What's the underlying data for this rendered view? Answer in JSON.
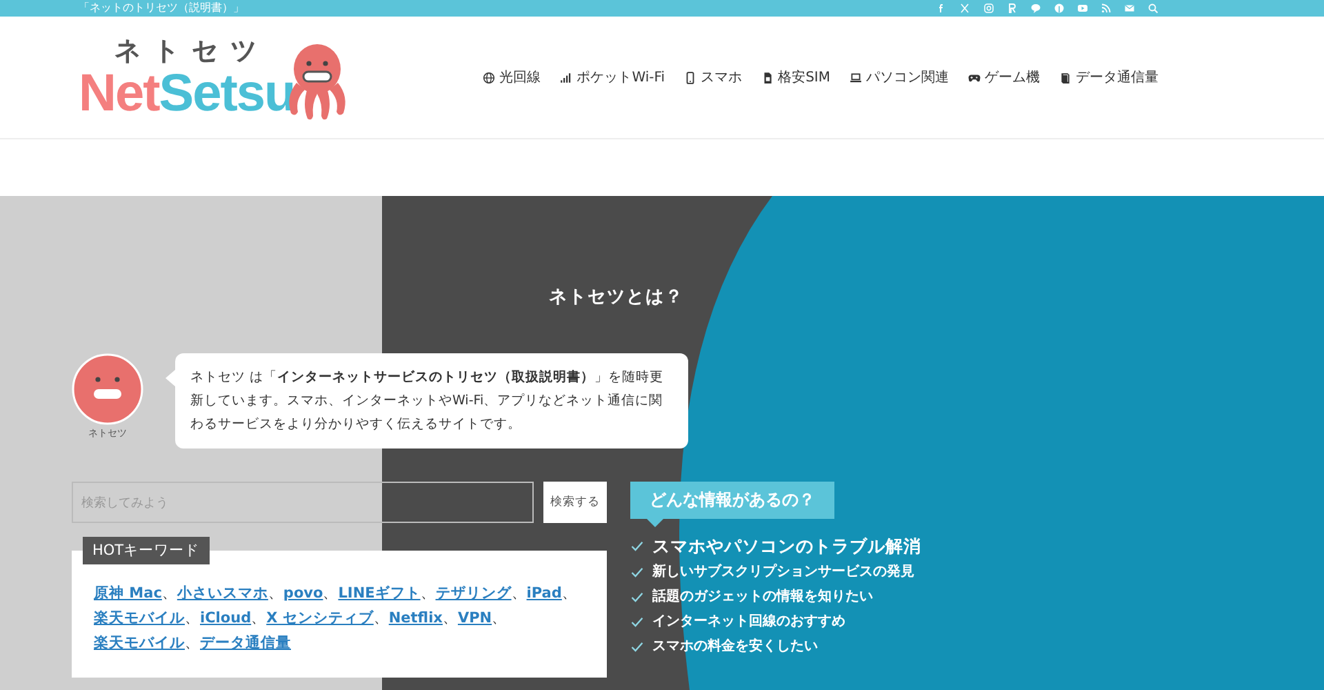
{
  "top_bar": {
    "tagline": "「ネットのトリセツ（説明書）」"
  },
  "logo": {
    "kana": "ネトセツ",
    "parts": [
      {
        "text": "Net",
        "color": "#f47f7f"
      },
      {
        "text": "Setsu",
        "color": "#4bbfd6"
      }
    ]
  },
  "nav": [
    {
      "label": "光回線"
    },
    {
      "label": "ポケットWi-Fi"
    },
    {
      "label": "スマホ"
    },
    {
      "label": "格安SIM"
    },
    {
      "label": "パソコン関連"
    },
    {
      "label": "ゲーム機"
    },
    {
      "label": "データ通信量"
    }
  ],
  "hero": {
    "title": "ネトセツとは？",
    "avatar_label": "ネトセツ",
    "intro": "ネトセツ は「**インターネットサービスのトリセツ（取扱説明書）**」を随時更新しています。スマホ、インターネットやWi-Fi、アプリなどネット通信に関わるサービスをより分かりやすく伝えるサイトです。",
    "search": {
      "placeholder": "検索してみよう",
      "button": "検索する"
    },
    "hot_label": "HOTキーワード",
    "keywords": [
      "原神 Mac",
      "小さいスマホ",
      "povo",
      "LINEギフト",
      "テザリング",
      "iPad",
      "楽天モバイル",
      "iCloud",
      "X センシティブ",
      "Netflix",
      "VPN",
      "楽天モバイル",
      "データ通信量"
    ],
    "separator": "、",
    "info_label": "どんな情報があるの？",
    "info_items": [
      {
        "text": "スマホやパソコンのトラブル解消",
        "emphasized": true
      },
      {
        "text": "新しいサブスクリプションサービスの発見",
        "emphasized": false
      },
      {
        "text": "話題のガジェットの情報を知りたい",
        "emphasized": false
      },
      {
        "text": "インターネット回線のおすすめ",
        "emphasized": false
      },
      {
        "text": "スマホの料金を安くしたい",
        "emphasized": false
      }
    ]
  }
}
